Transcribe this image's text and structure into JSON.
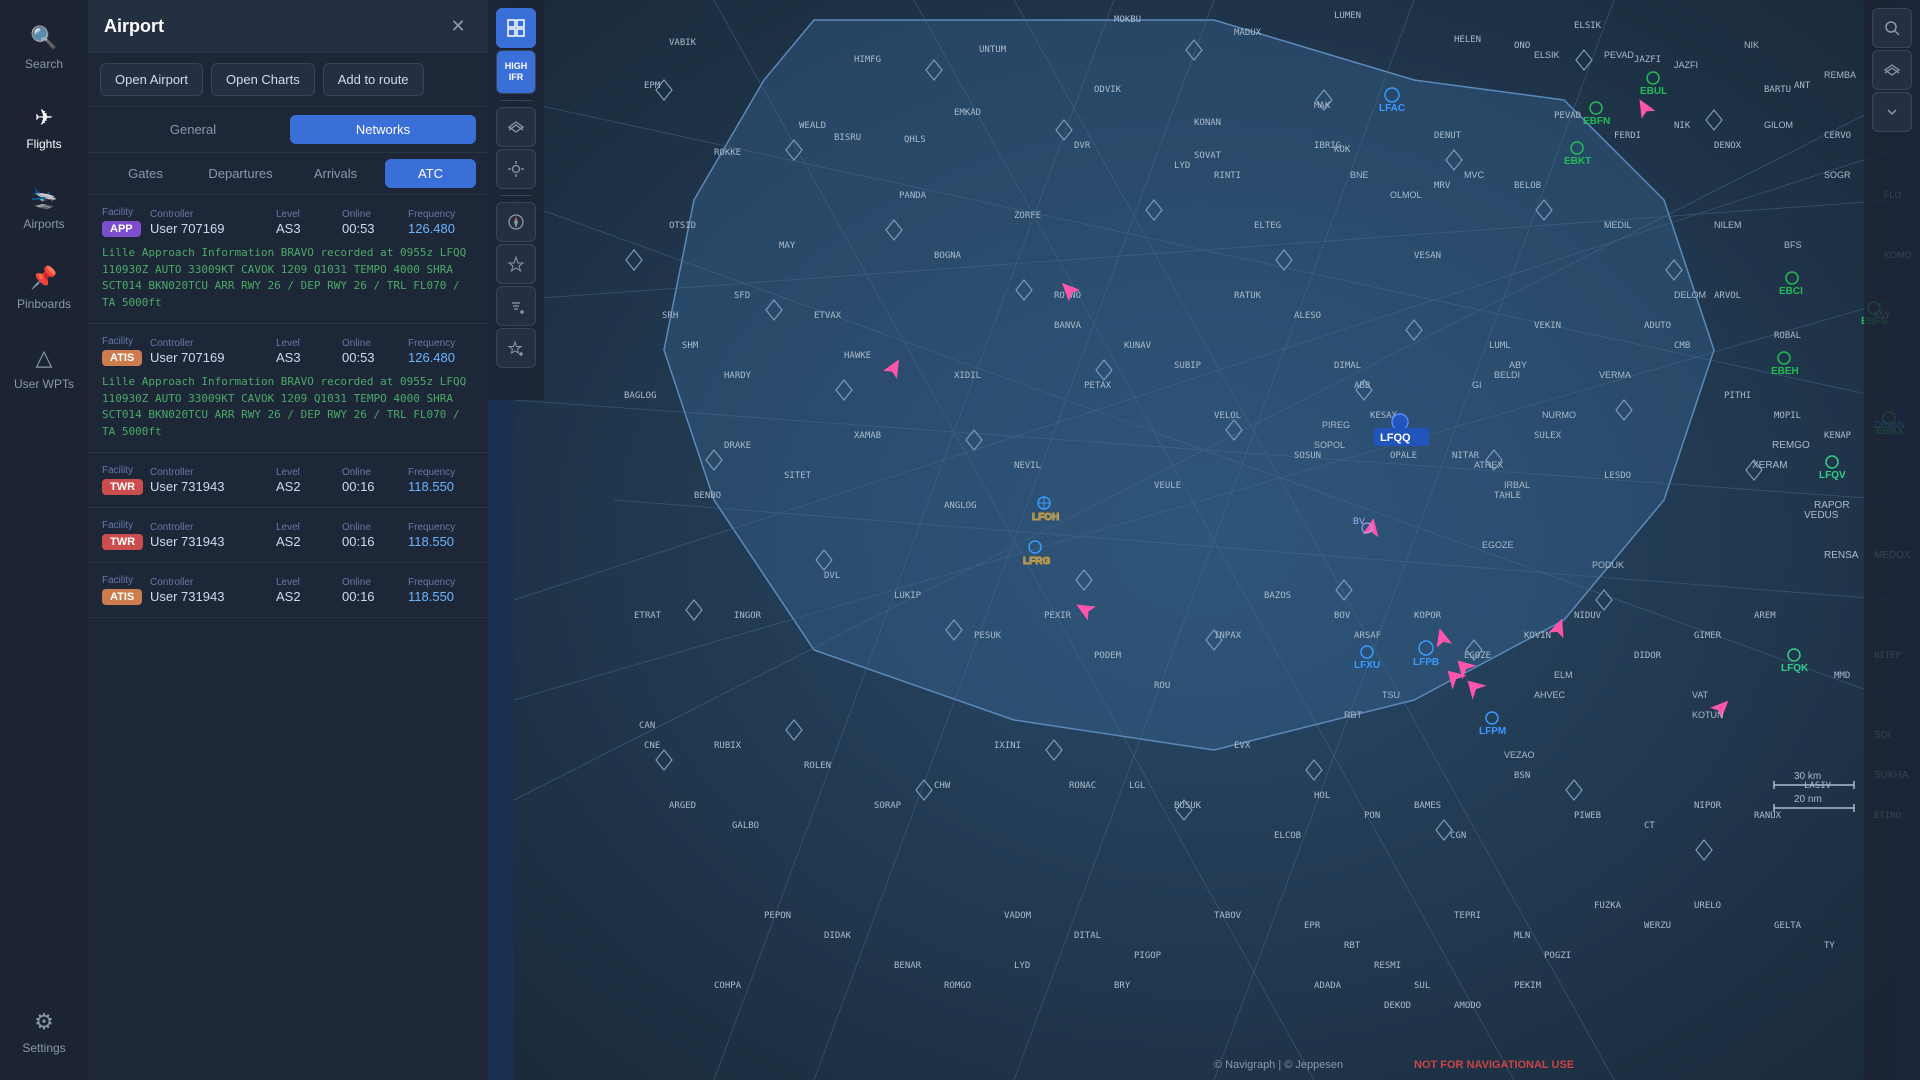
{
  "app": {
    "title": "Airport"
  },
  "leftNav": {
    "items": [
      {
        "id": "search",
        "label": "Search",
        "icon": "🔍"
      },
      {
        "id": "flights",
        "label": "Flights",
        "icon": "✈"
      },
      {
        "id": "airports",
        "label": "Airports",
        "icon": "🛬"
      },
      {
        "id": "pinboards",
        "label": "Pinboards",
        "icon": "📌"
      },
      {
        "id": "user-wpts",
        "label": "User WPTs",
        "icon": "△"
      },
      {
        "id": "settings",
        "label": "Settings",
        "icon": "⚙"
      }
    ]
  },
  "panel": {
    "title": "Airport",
    "buttons": {
      "open_airport": "Open Airport",
      "open_charts": "Open Charts",
      "add_to_route": "Add to route"
    },
    "tabs": {
      "general": "General",
      "networks": "Networks"
    },
    "subTabs": {
      "gates": "Gates",
      "departures": "Departures",
      "arrivals": "Arrivals",
      "atc": "ATC"
    },
    "activeTab": "networks",
    "activeSubTab": "atc"
  },
  "atcEntries": [
    {
      "id": 1,
      "facility": "APP",
      "badgeClass": "badge-app",
      "controller": "User 707169",
      "level": "AS3",
      "online": "00:53",
      "frequency": "126.480",
      "metar": "Lille Approach Information BRAVO recorded at 0955z LFQQ 110930Z AUTO 33009KT CAVOK 1209 Q1031 TEMPO 4000 SHRA SCT014 BKN020TCU ARR RWY 26 / DEP RWY 26 / TRL FL070 / TA 5000ft"
    },
    {
      "id": 2,
      "facility": "ATIS",
      "badgeClass": "badge-atis",
      "controller": "User 707169",
      "level": "AS3",
      "online": "00:53",
      "frequency": "126.480",
      "metar": "Lille Approach Information BRAVO recorded at 0955z LFQQ 110930Z AUTO 33009KT CAVOK 1209 Q1031 TEMPO 4000 SHRA SCT014 BKN020TCU ARR RWY 26 / DEP RWY 26 / TRL FL070 / TA 5000ft"
    },
    {
      "id": 3,
      "facility": "TWR",
      "badgeClass": "badge-twr",
      "controller": "User 731943",
      "level": "AS2",
      "online": "00:16",
      "frequency": "118.550",
      "metar": null
    },
    {
      "id": 4,
      "facility": "TWR",
      "badgeClass": "badge-twr",
      "controller": "User 731943",
      "level": "AS2",
      "online": "00:16",
      "frequency": "118.550",
      "metar": null
    },
    {
      "id": 5,
      "facility": "ATIS",
      "badgeClass": "badge-atis",
      "controller": "User 731943",
      "level": "AS2",
      "online": "00:16",
      "frequency": "118.550",
      "metar": null
    }
  ],
  "columnLabels": {
    "facility": "Facility",
    "controller": "Controller",
    "level": "Level",
    "online": "Online",
    "frequency": "Frequency"
  },
  "mapToolbar": {
    "highIfr": "HIGH\nIFR",
    "tools": [
      {
        "id": "layers",
        "icon": "⊞",
        "label": ""
      },
      {
        "id": "sun",
        "icon": "☀",
        "label": ""
      },
      {
        "id": "compass",
        "icon": "◎",
        "label": ""
      },
      {
        "id": "plane",
        "icon": "✈",
        "label": ""
      }
    ],
    "rightTools": [
      {
        "id": "search-r",
        "icon": "🔍"
      },
      {
        "id": "filter-r",
        "icon": "⊞"
      },
      {
        "id": "chevron-r",
        "icon": "▾"
      }
    ]
  },
  "map": {
    "airport_code": "LFQQ",
    "copyright": "© Navigraph | © Jeppesen",
    "warning": "NOT FOR NAVIGATIONAL USE",
    "scale": "30 km",
    "scale_small": "20 nm"
  }
}
